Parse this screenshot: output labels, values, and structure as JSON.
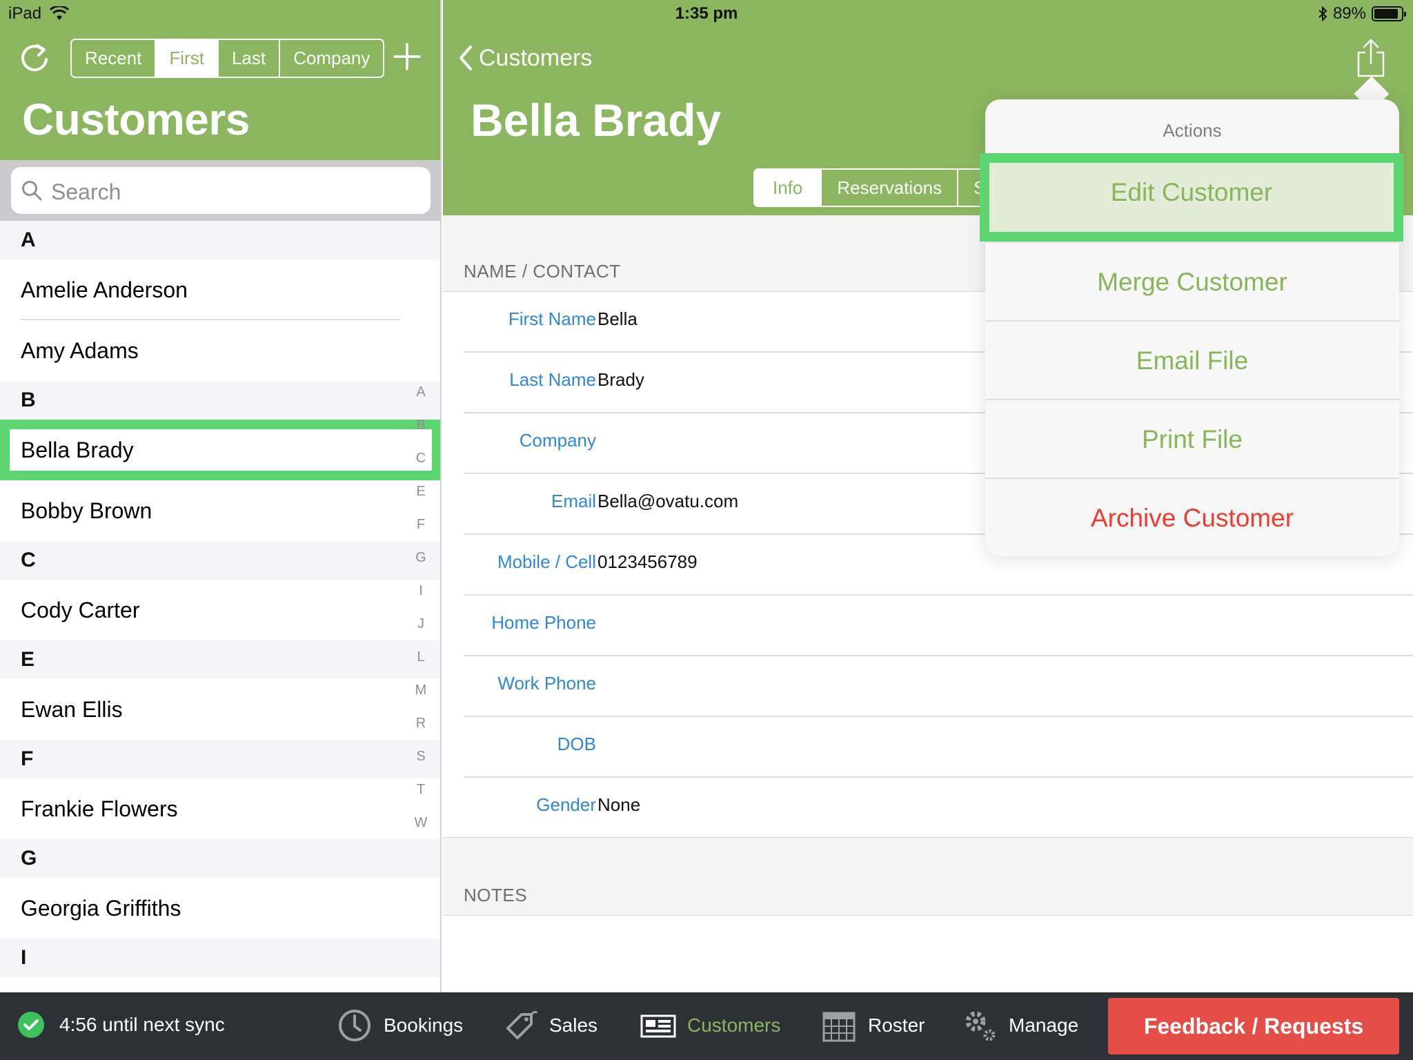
{
  "status_bar": {
    "device": "iPad",
    "time": "1:35 pm",
    "battery": "89%",
    "battery_level": 0.89
  },
  "left_pane": {
    "segments": [
      {
        "label": "Recent",
        "active": false
      },
      {
        "label": "First",
        "active": true
      },
      {
        "label": "Last",
        "active": false
      },
      {
        "label": "Company",
        "active": false
      }
    ],
    "title": "Customers",
    "search_placeholder": "Search",
    "sections": [
      {
        "letter": "A",
        "items": [
          "Amelie Anderson",
          "Amy Adams"
        ]
      },
      {
        "letter": "B",
        "items": [
          "Bella Brady",
          "Bobby Brown"
        ]
      },
      {
        "letter": "C",
        "items": [
          "Cody  Carter"
        ]
      },
      {
        "letter": "E",
        "items": [
          "Ewan Ellis"
        ]
      },
      {
        "letter": "F",
        "items": [
          "Frankie Flowers"
        ]
      },
      {
        "letter": "G",
        "items": [
          "Georgia Griffiths"
        ]
      },
      {
        "letter": "I",
        "items": []
      }
    ],
    "selected_customer": "Bella Brady",
    "index_letters": [
      "A",
      "B",
      "C",
      "E",
      "F",
      "G",
      "I",
      "J",
      "L",
      "M",
      "R",
      "S",
      "T",
      "W"
    ]
  },
  "detail": {
    "back_label": "Customers",
    "title": "Bella Brady",
    "tabs": [
      {
        "label": "Info",
        "active": true
      },
      {
        "label": "Reservations",
        "active": false
      },
      {
        "label": "S",
        "active": false
      }
    ],
    "section_contact": "NAME / CONTACT",
    "fields": [
      {
        "label": "First Name",
        "value": "Bella"
      },
      {
        "label": "Last Name",
        "value": "Brady"
      },
      {
        "label": "Company",
        "value": ""
      },
      {
        "label": "Email",
        "value": "Bella@ovatu.com"
      },
      {
        "label": "Mobile / Cell",
        "value": "0123456789"
      },
      {
        "label": "Home Phone",
        "value": ""
      },
      {
        "label": "Work Phone",
        "value": ""
      },
      {
        "label": "DOB",
        "value": ""
      },
      {
        "label": "Gender",
        "value": "None"
      }
    ],
    "section_notes": "NOTES"
  },
  "actions_popover": {
    "title": "Actions",
    "items": [
      {
        "label": "Edit Customer",
        "style": "normal",
        "selected": true
      },
      {
        "label": "Merge Customer",
        "style": "normal",
        "selected": false
      },
      {
        "label": "Email File",
        "style": "normal",
        "selected": false
      },
      {
        "label": "Print File",
        "style": "normal",
        "selected": false
      },
      {
        "label": "Archive Customer",
        "style": "danger",
        "selected": false
      }
    ]
  },
  "bottom_bar": {
    "sync_text": "4:56 until next sync",
    "nav": [
      {
        "label": "Bookings",
        "icon": "clock-icon",
        "active": false
      },
      {
        "label": "Sales",
        "icon": "tag-icon",
        "active": false
      },
      {
        "label": "Customers",
        "icon": "customers-icon",
        "active": true
      },
      {
        "label": "Roster",
        "icon": "calendar-icon",
        "active": false
      },
      {
        "label": "Manage",
        "icon": "gear-icon",
        "active": false
      }
    ],
    "feedback_label": "Feedback / Requests"
  },
  "colors": {
    "brand_green": "#8bb65f",
    "highlight_green": "#5cd470",
    "link_blue": "#2f87d8",
    "danger_red": "#ef3c30",
    "feedback_red": "#e44e47",
    "bottom_bar": "#2d3136"
  }
}
